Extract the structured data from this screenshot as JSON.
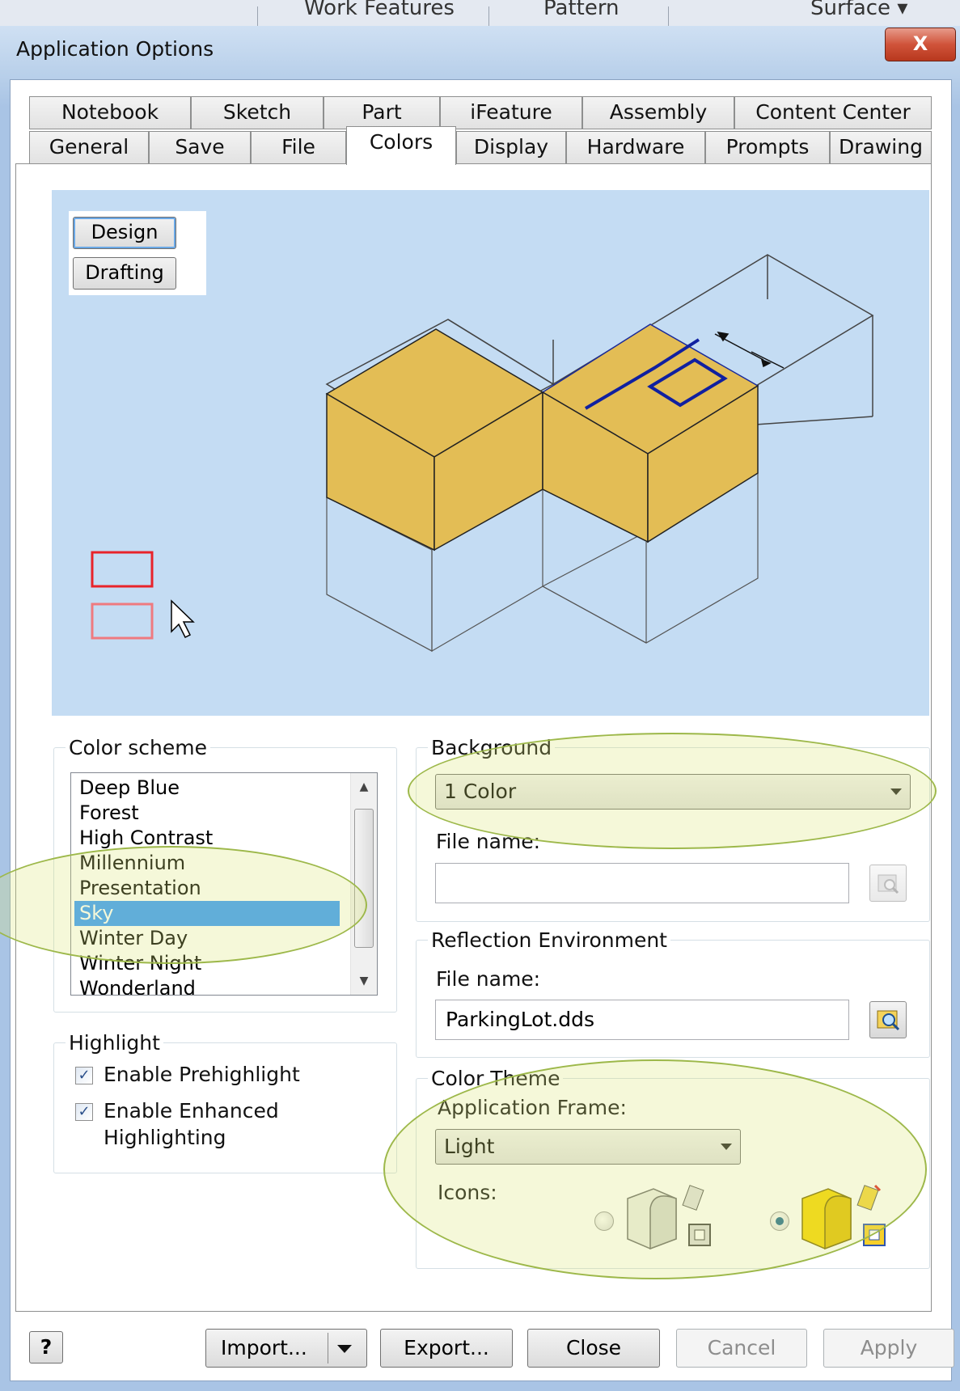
{
  "ribbon": {
    "items": [
      "Work Features",
      "Pattern",
      "Surface ▾"
    ]
  },
  "window": {
    "title": "Application Options",
    "close_glyph": "X"
  },
  "tabs": {
    "row1": [
      "Notebook",
      "Sketch",
      "Part",
      "iFeature",
      "Assembly",
      "Content Center"
    ],
    "row2": [
      "General",
      "Save",
      "File",
      "Colors",
      "Display",
      "Hardware",
      "Prompts",
      "Drawing"
    ],
    "active": "Colors"
  },
  "preview": {
    "design_label": "Design",
    "drafting_label": "Drafting",
    "background_color": "#c4dcf3",
    "part_color": "#e3bd55"
  },
  "color_scheme": {
    "label": "Color scheme",
    "items": [
      "Deep Blue",
      "Forest",
      "High Contrast",
      "Millennium",
      "Presentation",
      "Sky",
      "Winter Day",
      "Winter Night",
      "Wonderland"
    ],
    "selected": "Sky"
  },
  "background": {
    "label": "Background",
    "value": "1 Color",
    "file_label": "File name:",
    "file_value": ""
  },
  "reflection": {
    "label": "Reflection Environment",
    "file_label": "File name:",
    "file_value": "ParkingLot.dds"
  },
  "highlight": {
    "label": "Highlight",
    "prehighlight_label": "Enable Prehighlight",
    "enhanced_label_1": "Enable Enhanced",
    "enhanced_label_2": "Highlighting"
  },
  "color_theme": {
    "label": "Color Theme",
    "frame_label": "Application Frame:",
    "frame_value": "Light",
    "icons_label": "Icons:"
  },
  "buttons": {
    "help": "?",
    "import": "Import...",
    "export": "Export...",
    "close": "Close",
    "cancel": "Cancel",
    "apply": "Apply"
  }
}
